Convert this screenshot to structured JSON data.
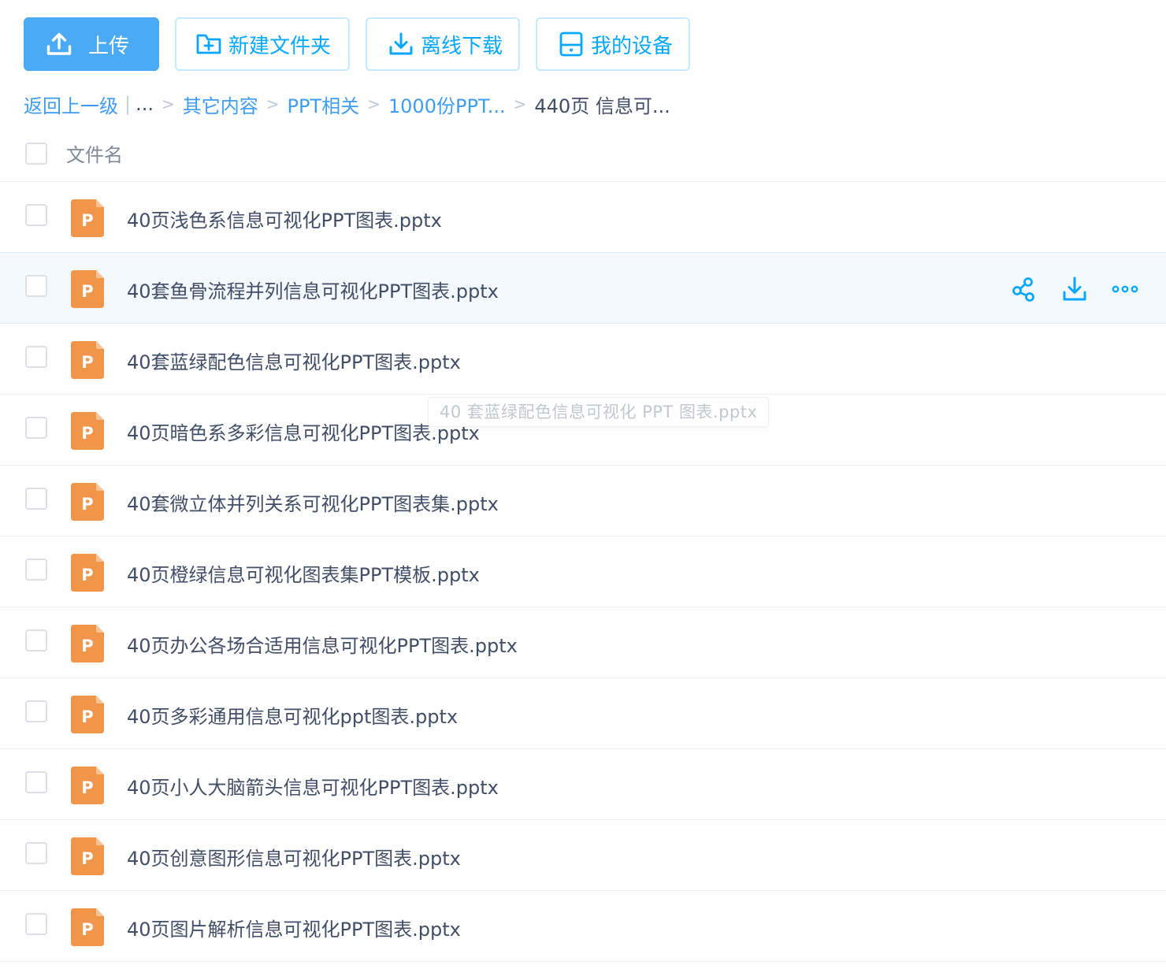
{
  "toolbar": {
    "upload_label": "上传",
    "new_folder_label": "新建文件夹",
    "offline_download_label": "离线下载",
    "my_devices_label": "我的设备"
  },
  "breadcrumb": {
    "back_label": "返回上一级",
    "pipe": "|",
    "ellipsis": "...",
    "separator": ">",
    "items": [
      "其它内容",
      "PPT相关",
      "1000份PPT...",
      "440页 信息可..."
    ]
  },
  "list": {
    "header_label": "文件名",
    "file_icon_letter": "P",
    "rows": [
      {
        "name": "40页浅色系信息可视化PPT图表.pptx"
      },
      {
        "name": "40套鱼骨流程并列信息可视化PPT图表.pptx"
      },
      {
        "name": "40套蓝绿配色信息可视化PPT图表.pptx"
      },
      {
        "name": "40页暗色系多彩信息可视化PPT图表.pptx"
      },
      {
        "name": "40套微立体并列关系可视化PPT图表集.pptx"
      },
      {
        "name": "40页橙绿信息可视化图表集PPT模板.pptx"
      },
      {
        "name": "40页办公各场合适用信息可视化PPT图表.pptx"
      },
      {
        "name": "40页多彩通用信息可视化ppt图表.pptx"
      },
      {
        "name": "40页小人大脑箭头信息可视化PPT图表.pptx"
      },
      {
        "name": "40页创意图形信息可视化PPT图表.pptx"
      },
      {
        "name": "40页图片解析信息可视化PPT图表.pptx"
      }
    ]
  },
  "tooltip": {
    "text": "40 套蓝绿配色信息可视化 PPT 图表.pptx"
  },
  "colors": {
    "accent": "#06a7ff",
    "primary_button": "#4aaaf5",
    "ppt_icon": "#f0954a",
    "hover_row": "#f3f9fe",
    "text": "#424e67"
  },
  "icons": {
    "upload": "upload-icon",
    "new_folder": "folder-plus-icon",
    "offline_download": "download-icon",
    "devices": "device-icon",
    "share": "share-icon",
    "download": "download-icon",
    "more": "more-icon",
    "file": "ppt-file-icon"
  }
}
